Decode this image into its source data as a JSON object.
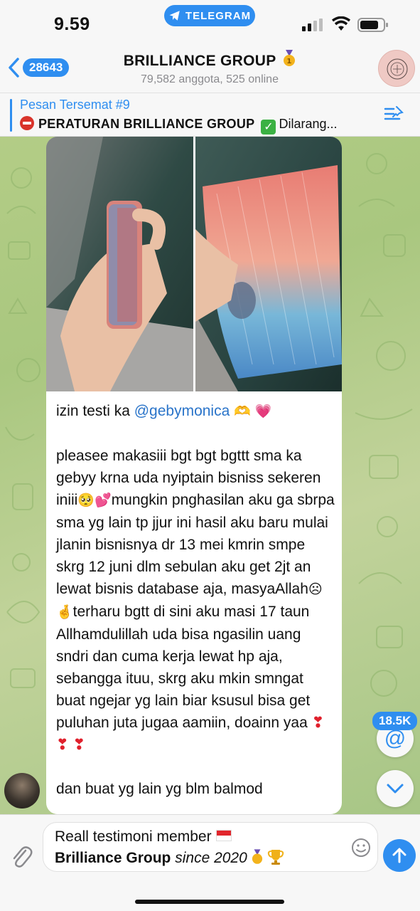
{
  "status": {
    "time": "9.59",
    "app_pill": "TELEGRAM"
  },
  "header": {
    "back_count": "28643",
    "title": "BRILLIANCE GROUP",
    "subtitle": "79,582 anggota, 525 online"
  },
  "pinned": {
    "title": "Pesan Tersemat #9",
    "text_bold": "PERATURAN BRILLIANCE GROUP",
    "text_rest": "Dilarang..."
  },
  "message": {
    "line_intro": "izin testi ka",
    "mention": "@gebymonica",
    "body1_a": "pleasee makasiii bgt bgt bgttt sma ka gebyy krna uda nyiptain bisniss sekeren iniii",
    "body1_b": "mungkin pnghasilan aku ga sbrpa sma yg lain tp jjur ini hasil aku baru mulai jlanin bisnisnya dr 13 mei kmrin smpe skrg 12 juni dlm sebulan aku get 2jt an lewat bisnis database aja, masyaAllah",
    "body1_c": "terharu bgtt di sini aku masi 17 taun Allhamdulillah uda bisa ngasilin uang sndri dan cuma kerja lewat hp aja, sebangga ituu, skrg aku mkin smngat buat ngejar yg lain biar ksusul bisa get puluhan juta jugaa aamiin, doainn yaa",
    "body2": "dan buat yg lain yg blm balmod"
  },
  "floating": {
    "mention_count": "18.5K",
    "at_symbol": "@"
  },
  "input": {
    "line1": "Reall testimoni member",
    "line2_bold": "Brilliance Group",
    "line2_italic": "since 2020"
  },
  "colors": {
    "accent": "#2f8ef0",
    "mention": "#2a74c9",
    "heart_red": "#e0202c"
  }
}
